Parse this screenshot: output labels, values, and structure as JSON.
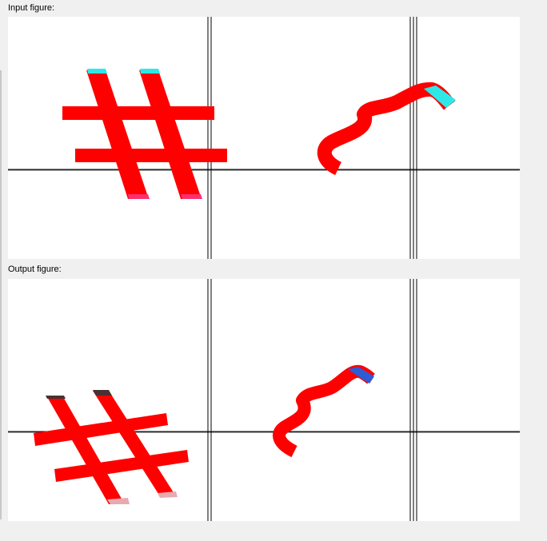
{
  "input_panel": {
    "label": "Input figure:",
    "symbols": [
      "hash",
      "brace"
    ],
    "colors": {
      "stroke": "#ff0000",
      "highlight": "#2ee8e8",
      "tip": "#ff2f6e",
      "axis": "#000000",
      "background": "#ffffff"
    }
  },
  "output_panel": {
    "label": "Output figure:",
    "symbols": [
      "hash",
      "brace"
    ],
    "colors": {
      "stroke": "#ff0000",
      "highlight": "#2e5bd6",
      "shadow_dark": "#4a3030",
      "shadow_light": "#e6aab0",
      "axis": "#000000",
      "background": "#ffffff"
    }
  },
  "window": {
    "background": "#f0f0f0"
  }
}
